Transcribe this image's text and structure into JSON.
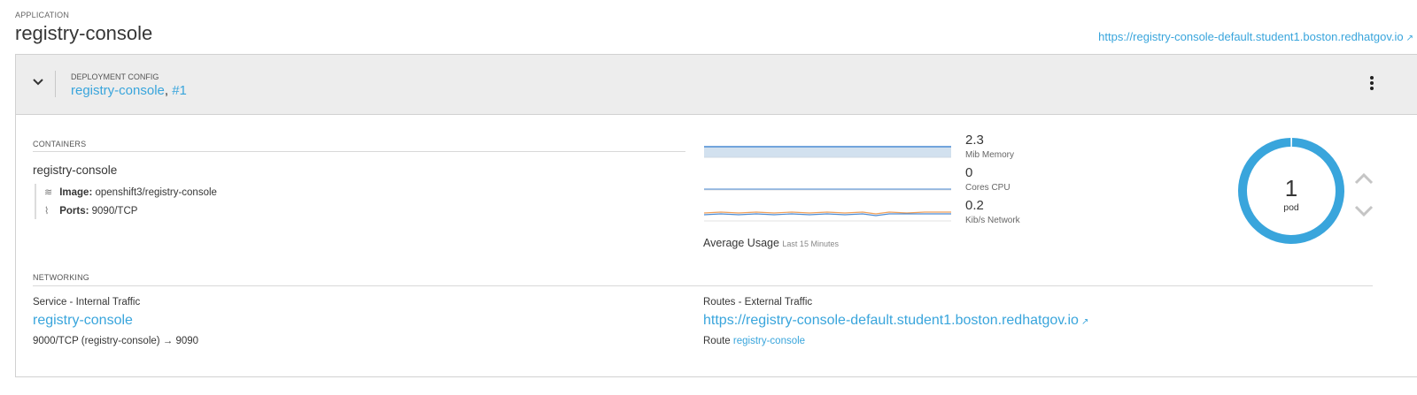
{
  "application": {
    "label": "APPLICATION",
    "name": "registry-console",
    "url": "https://registry-console-default.student1.boston.redhatgov.io"
  },
  "deployment": {
    "label": "DEPLOYMENT CONFIG",
    "name": "registry-console",
    "separator": ",",
    "version": "#1"
  },
  "containers": {
    "label": "CONTAINERS",
    "name": "registry-console",
    "image_label": "Image:",
    "image_value": "openshift3/registry-console",
    "ports_label": "Ports:",
    "ports_value": "9090/TCP",
    "image_icon": "layers-icon",
    "ports_icon": "pulse-icon"
  },
  "metrics": {
    "memory_value": "2.3",
    "memory_unit": "Mib Memory",
    "cpu_value": "0",
    "cpu_unit": "Cores CPU",
    "network_value": "0.2",
    "network_unit": "Kib/s Network",
    "average_label": "Average Usage",
    "average_period": "Last 15 Minutes"
  },
  "pods": {
    "count": "1",
    "label": "pod",
    "ring_fill_fraction": 1.0
  },
  "networking": {
    "label": "NETWORKING",
    "service_heading": "Service - Internal Traffic",
    "service_name": "registry-console",
    "service_ports": "9000/TCP (registry-console) → 9090",
    "routes_heading": "Routes - External Traffic",
    "route_url": "https://registry-console-default.student1.boston.redhatgov.io",
    "route_prefix": "Route",
    "route_name": "registry-console"
  },
  "colors": {
    "link": "#39a5dc",
    "donut": "#39a5dc",
    "header_bg": "#ededed",
    "memory_line": "#4a8ad3",
    "memory_fill": "#d2e1ef",
    "network_line_a": "#f0a05a",
    "network_line_b": "#4a8ad3"
  }
}
